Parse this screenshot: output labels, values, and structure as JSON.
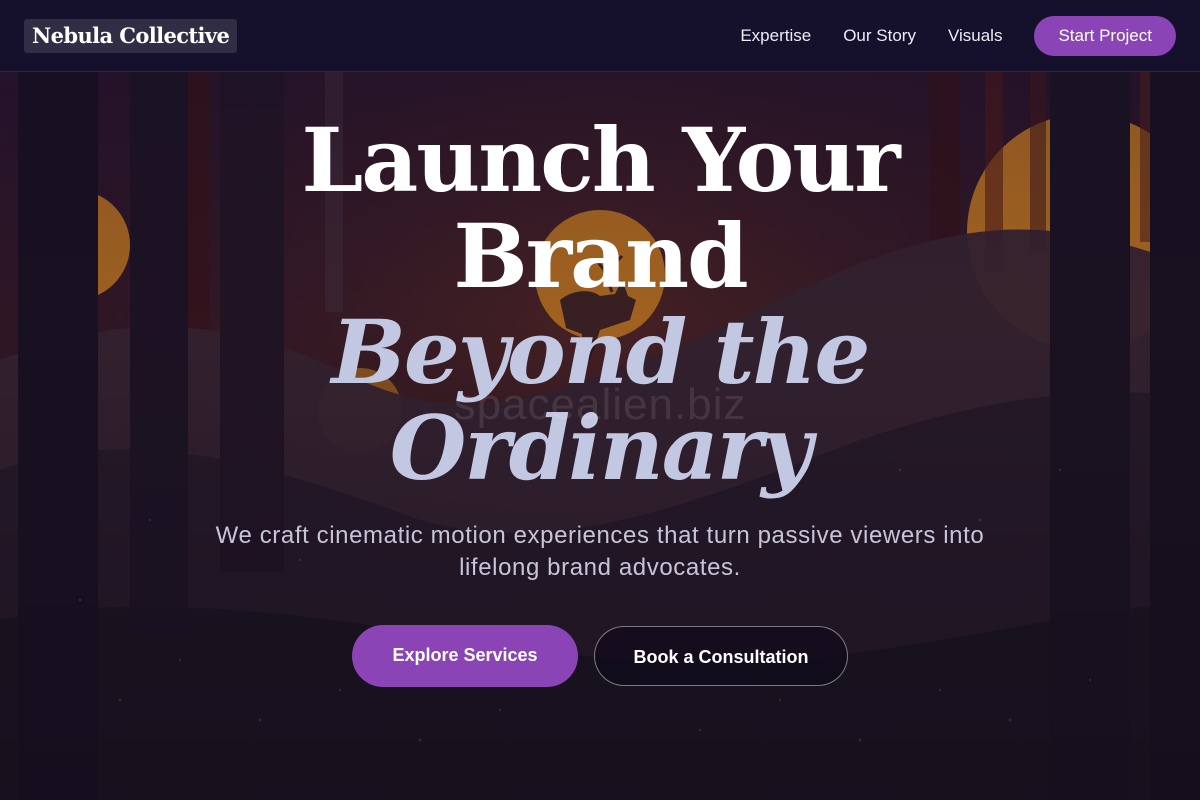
{
  "header": {
    "brand": "Nebula Collective",
    "nav": [
      {
        "label": "Expertise"
      },
      {
        "label": "Our Story"
      },
      {
        "label": "Visuals"
      }
    ],
    "cta_label": "Start Project"
  },
  "hero": {
    "headline_line_1": "Launch Your",
    "headline_line_2": "Brand",
    "headline_line_3": "Beyond the",
    "headline_line_4": "Ordinary",
    "subtitle": "We craft cinematic motion experiences that turn passive viewers into lifelong brand advocates.",
    "primary_button": "Explore Services",
    "secondary_button": "Book a Consultation",
    "watermark": "spacealien.biz"
  },
  "colors": {
    "accent": "#8a44b6",
    "header_bg": "#14102c",
    "headline": "#ffffff",
    "headline_accent": "#c2c7e2",
    "sun": "#d9861f"
  },
  "background": {
    "scene": "forest-sunset-deer-illustration"
  }
}
